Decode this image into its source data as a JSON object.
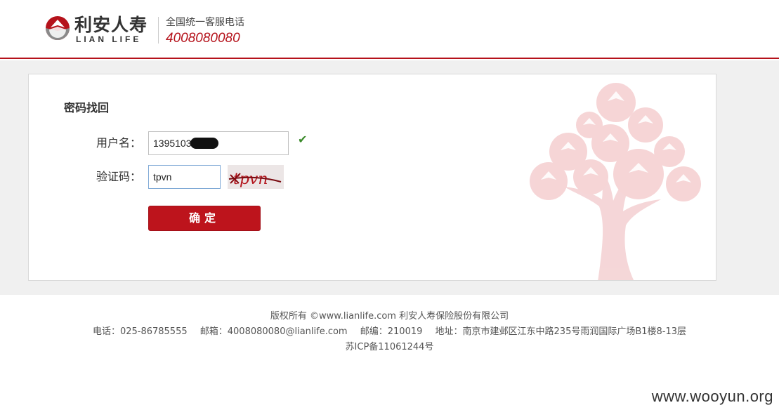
{
  "header": {
    "logo_cn": "利安人寿",
    "logo_en": "LIAN LIFE",
    "hotline_label": "全国统一客服电话",
    "hotline_number": "4008080080",
    "brand_color": "#b5121b"
  },
  "form": {
    "title": "密码找回",
    "username_label": "用户名：",
    "username_value": "1395103",
    "username_valid_icon": "check-icon",
    "captcha_label": "验证码：",
    "captcha_value": "tpvn",
    "captcha_image_text": "tpvn",
    "submit_label": "确定"
  },
  "footer": {
    "copyright": "版权所有 ©www.lianlife.com 利安人寿保险股份有限公司",
    "phone": "电话：025-86785555",
    "email": "邮箱：4008080080@lianlife.com",
    "postcode": "邮编：210019",
    "address": "地址：南京市建邺区江东中路235号雨润国际广场B1楼8-13层",
    "icp": "苏ICP备11061244号"
  },
  "watermark": "www.wooyun.org"
}
